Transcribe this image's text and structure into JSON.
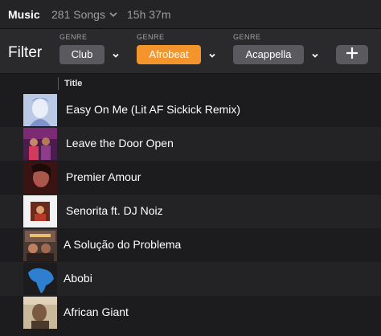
{
  "header": {
    "app_title": "Music",
    "song_count": "281 Songs",
    "duration": "15h 37m"
  },
  "filter": {
    "label": "Filter",
    "genres": [
      {
        "caption": "GENRE",
        "value": "Club",
        "active": false
      },
      {
        "caption": "GENRE",
        "value": "Afrobeat",
        "active": true
      },
      {
        "caption": "GENRE",
        "value": "Acappella",
        "active": false
      }
    ],
    "add_label": "+"
  },
  "table": {
    "column_title": "Title",
    "rows": [
      {
        "title": "Easy On Me (Lit AF Sickick Remix)",
        "art_icon": "album-art-blue-portrait"
      },
      {
        "title": "Leave the Door Open",
        "art_icon": "album-art-purple-group"
      },
      {
        "title": "Premier Amour",
        "art_icon": "album-art-dark-red-portrait"
      },
      {
        "title": "Senorita ft. DJ Noiz",
        "art_icon": "album-art-white-frame"
      },
      {
        "title": "A Solução do Problema",
        "art_icon": "album-art-poster"
      },
      {
        "title": "Abobi",
        "art_icon": "album-art-blue-map"
      },
      {
        "title": "African Giant",
        "art_icon": "album-art-tan-portrait"
      }
    ]
  },
  "colors": {
    "accent": "#f3952c",
    "pill": "#5a5a5e",
    "background": "#1c1c1e"
  }
}
